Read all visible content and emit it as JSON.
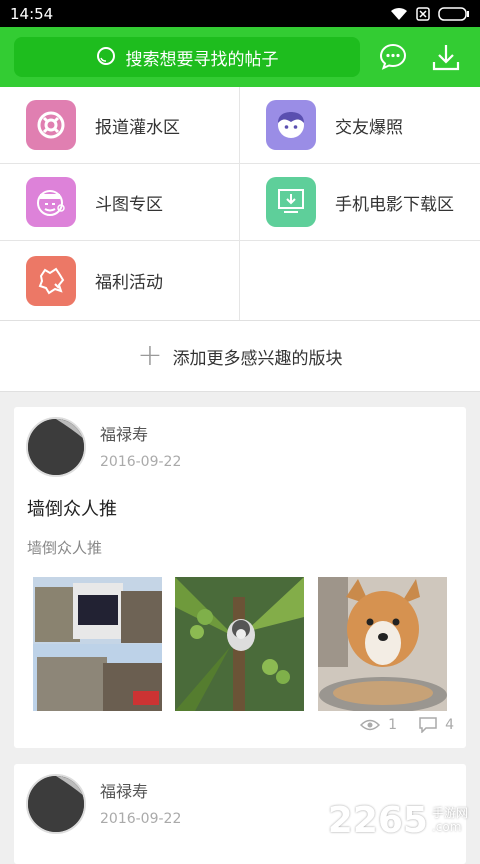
{
  "status_bar": {
    "time": "14:54"
  },
  "header": {
    "search_placeholder": "搜索想要寻找的帖子",
    "message_icon": "message-icon",
    "download_icon": "download-icon"
  },
  "forums": [
    {
      "label": "报道灌水区",
      "icon": "lifebuoy-icon",
      "color": "#e07fb1"
    },
    {
      "label": "交友爆照",
      "icon": "face-icon",
      "color": "#9a8de6"
    },
    {
      "label": "斗图专区",
      "icon": "emoji-icon",
      "color": "#dd82d9"
    },
    {
      "label": "手机电影下载区",
      "icon": "tv-download-icon",
      "color": "#5ecf9a"
    },
    {
      "label": "福利活动",
      "icon": "puzzle-icon",
      "color": "#ec7866"
    }
  ],
  "add_more": {
    "label": "添加更多感兴趣的版块"
  },
  "posts": [
    {
      "author": "福禄寿",
      "date": "2016-09-22",
      "title": "墙倒众人推",
      "body": "墙倒众人推",
      "views": "1",
      "comments": "4"
    },
    {
      "author": "福禄寿",
      "date": "2016-09-22"
    }
  ],
  "watermark": {
    "number": "2265",
    "site_cn": "手游网",
    "site_en": ".com"
  }
}
